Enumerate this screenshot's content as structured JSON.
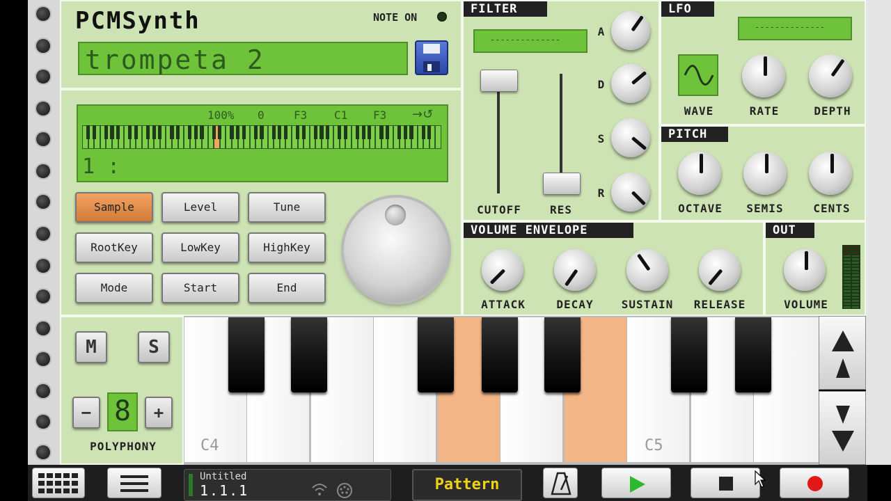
{
  "header": {
    "title": "PCMSynth",
    "note_on_label": "NOTE ON",
    "preset_name": "trompeta 2"
  },
  "sample_display": {
    "values": [
      "100%",
      "0",
      "F3",
      "C1",
      "F3"
    ],
    "line": "1 :"
  },
  "buttons": [
    {
      "label": "Sample",
      "active": true
    },
    {
      "label": "Level",
      "active": false
    },
    {
      "label": "Tune",
      "active": false
    },
    {
      "label": "RootKey",
      "active": false
    },
    {
      "label": "LowKey",
      "active": false
    },
    {
      "label": "HighKey",
      "active": false
    },
    {
      "label": "Mode",
      "active": false
    },
    {
      "label": "Start",
      "active": false
    },
    {
      "label": "End",
      "active": false
    }
  ],
  "filter": {
    "title": "FILTER",
    "lcd": "--------------",
    "cutoff_label": "CUTOFF",
    "res_label": "RES",
    "env_labels": [
      "A",
      "D",
      "S",
      "R"
    ]
  },
  "lfo": {
    "title": "LFO",
    "lcd": "--------------",
    "wave_label": "WAVE",
    "rate_label": "RATE",
    "depth_label": "DEPTH"
  },
  "pitch": {
    "title": "PITCH",
    "labels": [
      "OCTAVE",
      "SEMIS",
      "CENTS"
    ]
  },
  "volume_envelope": {
    "title": "VOLUME ENVELOPE",
    "labels": [
      "ATTACK",
      "DECAY",
      "SUSTAIN",
      "RELEASE"
    ]
  },
  "out": {
    "title": "OUT",
    "volume_label": "VOLUME"
  },
  "keyboard_controls": {
    "mute": "M",
    "solo": "S",
    "minus": "−",
    "plus": "+",
    "polyphony_value": "8",
    "polyphony_label": "POLYPHONY"
  },
  "keyboard": {
    "c4_label": "C4",
    "c5_label": "C5"
  },
  "transport": {
    "song_name": "Untitled",
    "position": "1.1.1",
    "pattern_label": "Pattern"
  },
  "colors": {
    "lcd_green": "#6fc33a",
    "panel_green": "#cde3b3",
    "pressed_key": "#f2b585",
    "active_button": "#e08a48"
  }
}
